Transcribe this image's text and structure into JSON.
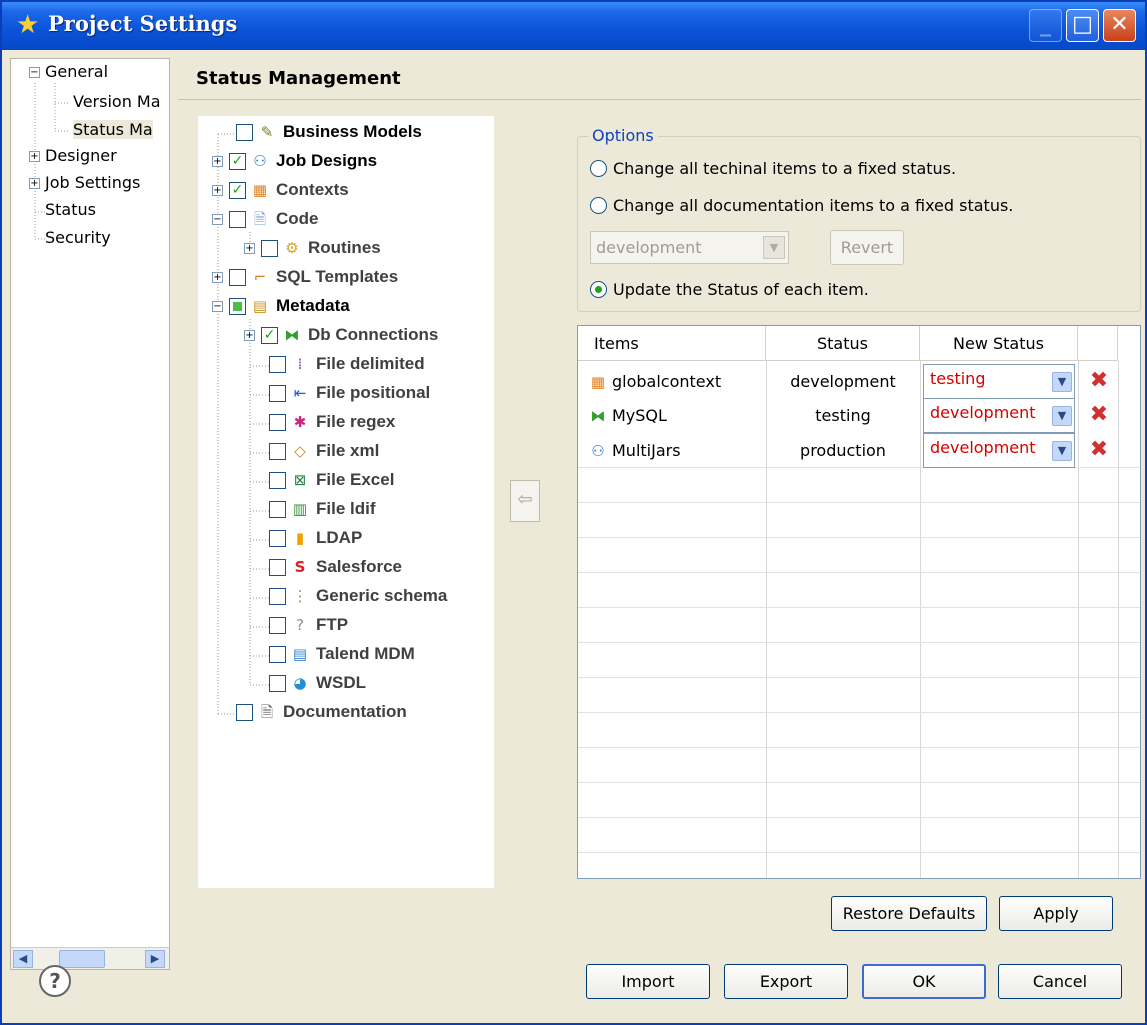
{
  "window": {
    "title": "Project Settings",
    "title_icon": "project-settings-icon",
    "buttons": {
      "minimize": "_",
      "maximize": "□",
      "close": "✕"
    }
  },
  "sidebar": {
    "items": [
      {
        "label": "General",
        "expander": "−"
      },
      {
        "label": "Version Ma"
      },
      {
        "label": "Status Ma"
      },
      {
        "label": "Designer",
        "expander": "+"
      },
      {
        "label": "Job Settings",
        "expander": "+"
      },
      {
        "label": "Status"
      },
      {
        "label": "Security"
      }
    ],
    "scroll_left": "◀",
    "scroll_right": "▶"
  },
  "header": {
    "title": "Status Management"
  },
  "tree": {
    "items": [
      {
        "label": "Business Models",
        "expander": "",
        "checked": "",
        "icon": "business-models-icon"
      },
      {
        "label": "Job Designs",
        "expander": "+",
        "checked": "✓",
        "icon": "job-designs-icon"
      },
      {
        "label": "Contexts",
        "expander": "+",
        "checked": "✓",
        "icon": "contexts-icon"
      },
      {
        "label": "Code",
        "expander": "−",
        "checked": "",
        "icon": "code-icon"
      },
      {
        "label": "Routines",
        "expander": "+",
        "checked": "",
        "icon": "routines-icon"
      },
      {
        "label": "SQL Templates",
        "expander": "+",
        "checked": "",
        "icon": "sql-templates-icon"
      },
      {
        "label": "Metadata",
        "expander": "−",
        "checked": "partial",
        "icon": "metadata-icon"
      },
      {
        "label": "Db Connections",
        "expander": "+",
        "checked": "✓",
        "icon": "db-connections-icon"
      },
      {
        "label": "File delimited",
        "checked": "",
        "icon": "file-delimited-icon"
      },
      {
        "label": "File positional",
        "checked": "",
        "icon": "file-positional-icon"
      },
      {
        "label": "File regex",
        "checked": "",
        "icon": "file-regex-icon"
      },
      {
        "label": "File xml",
        "checked": "",
        "icon": "file-xml-icon"
      },
      {
        "label": "File Excel",
        "checked": "",
        "icon": "file-excel-icon"
      },
      {
        "label": "File ldif",
        "checked": "",
        "icon": "file-ldif-icon"
      },
      {
        "label": "LDAP",
        "checked": "",
        "icon": "ldap-icon"
      },
      {
        "label": "Salesforce",
        "checked": "",
        "icon": "salesforce-icon"
      },
      {
        "label": "Generic schema",
        "checked": "",
        "icon": "generic-schema-icon"
      },
      {
        "label": "FTP",
        "checked": "",
        "icon": "ftp-icon"
      },
      {
        "label": "Talend MDM",
        "checked": "",
        "icon": "talend-mdm-icon"
      },
      {
        "label": "WSDL",
        "checked": "",
        "icon": "wsdl-icon"
      },
      {
        "label": "Documentation",
        "checked": "",
        "icon": "documentation-icon"
      }
    ]
  },
  "mover_button": "⇦",
  "options": {
    "legend": "Options",
    "radio_technical": "Change all techinal items to a fixed status.",
    "radio_documentation": "Change all documentation items to a fixed status.",
    "status_dropdown_value": "development",
    "revert_label": "Revert",
    "radio_update": "Update the Status of each item.",
    "selected": "update"
  },
  "table": {
    "columns": [
      "Items",
      "Status",
      "New Status"
    ],
    "rows": [
      {
        "item": "globalcontext",
        "icon": "contexts-icon",
        "status": "development",
        "new_status": "testing"
      },
      {
        "item": "MySQL",
        "icon": "db-connections-icon",
        "status": "testing",
        "new_status": "development"
      },
      {
        "item": "MultiJars",
        "icon": "job-designs-icon",
        "status": "production",
        "new_status": "development"
      }
    ]
  },
  "buttons": {
    "restore_defaults": "Restore Defaults",
    "apply": "Apply",
    "import": "Import",
    "export": "Export",
    "ok": "OK",
    "cancel": "Cancel",
    "help": "?"
  },
  "colors": {
    "title_bar": "#0a52d8",
    "accent_link": "#1040c0",
    "new_status_text": "#d60000",
    "check_green": "#21a121",
    "delete_red": "#d03030"
  }
}
